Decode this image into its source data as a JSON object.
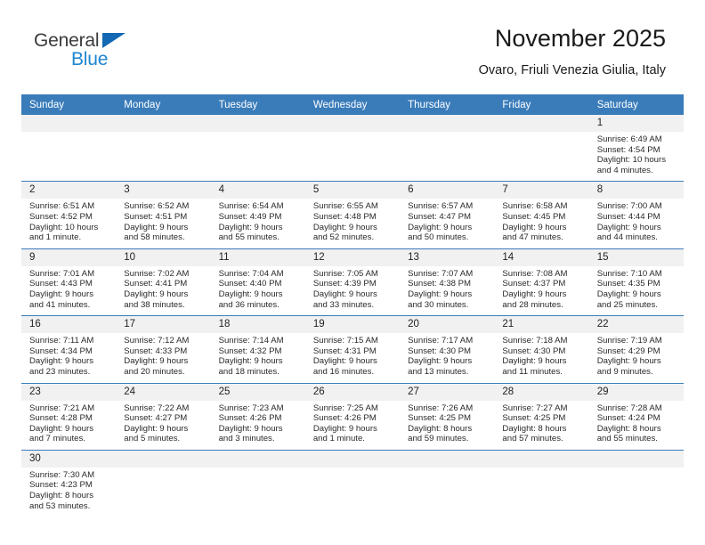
{
  "brand": {
    "word1": "General",
    "word2": "Blue",
    "accent_color": "#1268b3",
    "blue_text_color": "#1f86d0"
  },
  "header": {
    "title": "November 2025",
    "subtitle": "Ovaro, Friuli Venezia Giulia, Italy",
    "header_bg": "#3a7cba",
    "daynum_bg": "#f1f1f1"
  },
  "weekday_headers": [
    "Sunday",
    "Monday",
    "Tuesday",
    "Wednesday",
    "Thursday",
    "Friday",
    "Saturday"
  ],
  "labels": {
    "sunrise": "Sunrise:",
    "sunset": "Sunset:",
    "daylight": "Daylight:"
  },
  "weeks": [
    [
      {
        "day": ""
      },
      {
        "day": ""
      },
      {
        "day": ""
      },
      {
        "day": ""
      },
      {
        "day": ""
      },
      {
        "day": ""
      },
      {
        "day": "1",
        "sunrise": "Sunrise: 6:49 AM",
        "sunset": "Sunset: 4:54 PM",
        "daylight1": "Daylight: 10 hours",
        "daylight2": "and 4 minutes."
      }
    ],
    [
      {
        "day": "2",
        "sunrise": "Sunrise: 6:51 AM",
        "sunset": "Sunset: 4:52 PM",
        "daylight1": "Daylight: 10 hours",
        "daylight2": "and 1 minute."
      },
      {
        "day": "3",
        "sunrise": "Sunrise: 6:52 AM",
        "sunset": "Sunset: 4:51 PM",
        "daylight1": "Daylight: 9 hours",
        "daylight2": "and 58 minutes."
      },
      {
        "day": "4",
        "sunrise": "Sunrise: 6:54 AM",
        "sunset": "Sunset: 4:49 PM",
        "daylight1": "Daylight: 9 hours",
        "daylight2": "and 55 minutes."
      },
      {
        "day": "5",
        "sunrise": "Sunrise: 6:55 AM",
        "sunset": "Sunset: 4:48 PM",
        "daylight1": "Daylight: 9 hours",
        "daylight2": "and 52 minutes."
      },
      {
        "day": "6",
        "sunrise": "Sunrise: 6:57 AM",
        "sunset": "Sunset: 4:47 PM",
        "daylight1": "Daylight: 9 hours",
        "daylight2": "and 50 minutes."
      },
      {
        "day": "7",
        "sunrise": "Sunrise: 6:58 AM",
        "sunset": "Sunset: 4:45 PM",
        "daylight1": "Daylight: 9 hours",
        "daylight2": "and 47 minutes."
      },
      {
        "day": "8",
        "sunrise": "Sunrise: 7:00 AM",
        "sunset": "Sunset: 4:44 PM",
        "daylight1": "Daylight: 9 hours",
        "daylight2": "and 44 minutes."
      }
    ],
    [
      {
        "day": "9",
        "sunrise": "Sunrise: 7:01 AM",
        "sunset": "Sunset: 4:43 PM",
        "daylight1": "Daylight: 9 hours",
        "daylight2": "and 41 minutes."
      },
      {
        "day": "10",
        "sunrise": "Sunrise: 7:02 AM",
        "sunset": "Sunset: 4:41 PM",
        "daylight1": "Daylight: 9 hours",
        "daylight2": "and 38 minutes."
      },
      {
        "day": "11",
        "sunrise": "Sunrise: 7:04 AM",
        "sunset": "Sunset: 4:40 PM",
        "daylight1": "Daylight: 9 hours",
        "daylight2": "and 36 minutes."
      },
      {
        "day": "12",
        "sunrise": "Sunrise: 7:05 AM",
        "sunset": "Sunset: 4:39 PM",
        "daylight1": "Daylight: 9 hours",
        "daylight2": "and 33 minutes."
      },
      {
        "day": "13",
        "sunrise": "Sunrise: 7:07 AM",
        "sunset": "Sunset: 4:38 PM",
        "daylight1": "Daylight: 9 hours",
        "daylight2": "and 30 minutes."
      },
      {
        "day": "14",
        "sunrise": "Sunrise: 7:08 AM",
        "sunset": "Sunset: 4:37 PM",
        "daylight1": "Daylight: 9 hours",
        "daylight2": "and 28 minutes."
      },
      {
        "day": "15",
        "sunrise": "Sunrise: 7:10 AM",
        "sunset": "Sunset: 4:35 PM",
        "daylight1": "Daylight: 9 hours",
        "daylight2": "and 25 minutes."
      }
    ],
    [
      {
        "day": "16",
        "sunrise": "Sunrise: 7:11 AM",
        "sunset": "Sunset: 4:34 PM",
        "daylight1": "Daylight: 9 hours",
        "daylight2": "and 23 minutes."
      },
      {
        "day": "17",
        "sunrise": "Sunrise: 7:12 AM",
        "sunset": "Sunset: 4:33 PM",
        "daylight1": "Daylight: 9 hours",
        "daylight2": "and 20 minutes."
      },
      {
        "day": "18",
        "sunrise": "Sunrise: 7:14 AM",
        "sunset": "Sunset: 4:32 PM",
        "daylight1": "Daylight: 9 hours",
        "daylight2": "and 18 minutes."
      },
      {
        "day": "19",
        "sunrise": "Sunrise: 7:15 AM",
        "sunset": "Sunset: 4:31 PM",
        "daylight1": "Daylight: 9 hours",
        "daylight2": "and 16 minutes."
      },
      {
        "day": "20",
        "sunrise": "Sunrise: 7:17 AM",
        "sunset": "Sunset: 4:30 PM",
        "daylight1": "Daylight: 9 hours",
        "daylight2": "and 13 minutes."
      },
      {
        "day": "21",
        "sunrise": "Sunrise: 7:18 AM",
        "sunset": "Sunset: 4:30 PM",
        "daylight1": "Daylight: 9 hours",
        "daylight2": "and 11 minutes."
      },
      {
        "day": "22",
        "sunrise": "Sunrise: 7:19 AM",
        "sunset": "Sunset: 4:29 PM",
        "daylight1": "Daylight: 9 hours",
        "daylight2": "and 9 minutes."
      }
    ],
    [
      {
        "day": "23",
        "sunrise": "Sunrise: 7:21 AM",
        "sunset": "Sunset: 4:28 PM",
        "daylight1": "Daylight: 9 hours",
        "daylight2": "and 7 minutes."
      },
      {
        "day": "24",
        "sunrise": "Sunrise: 7:22 AM",
        "sunset": "Sunset: 4:27 PM",
        "daylight1": "Daylight: 9 hours",
        "daylight2": "and 5 minutes."
      },
      {
        "day": "25",
        "sunrise": "Sunrise: 7:23 AM",
        "sunset": "Sunset: 4:26 PM",
        "daylight1": "Daylight: 9 hours",
        "daylight2": "and 3 minutes."
      },
      {
        "day": "26",
        "sunrise": "Sunrise: 7:25 AM",
        "sunset": "Sunset: 4:26 PM",
        "daylight1": "Daylight: 9 hours",
        "daylight2": "and 1 minute."
      },
      {
        "day": "27",
        "sunrise": "Sunrise: 7:26 AM",
        "sunset": "Sunset: 4:25 PM",
        "daylight1": "Daylight: 8 hours",
        "daylight2": "and 59 minutes."
      },
      {
        "day": "28",
        "sunrise": "Sunrise: 7:27 AM",
        "sunset": "Sunset: 4:25 PM",
        "daylight1": "Daylight: 8 hours",
        "daylight2": "and 57 minutes."
      },
      {
        "day": "29",
        "sunrise": "Sunrise: 7:28 AM",
        "sunset": "Sunset: 4:24 PM",
        "daylight1": "Daylight: 8 hours",
        "daylight2": "and 55 minutes."
      }
    ],
    [
      {
        "day": "30",
        "sunrise": "Sunrise: 7:30 AM",
        "sunset": "Sunset: 4:23 PM",
        "daylight1": "Daylight: 8 hours",
        "daylight2": "and 53 minutes."
      },
      {
        "day": ""
      },
      {
        "day": ""
      },
      {
        "day": ""
      },
      {
        "day": ""
      },
      {
        "day": ""
      },
      {
        "day": ""
      }
    ]
  ]
}
